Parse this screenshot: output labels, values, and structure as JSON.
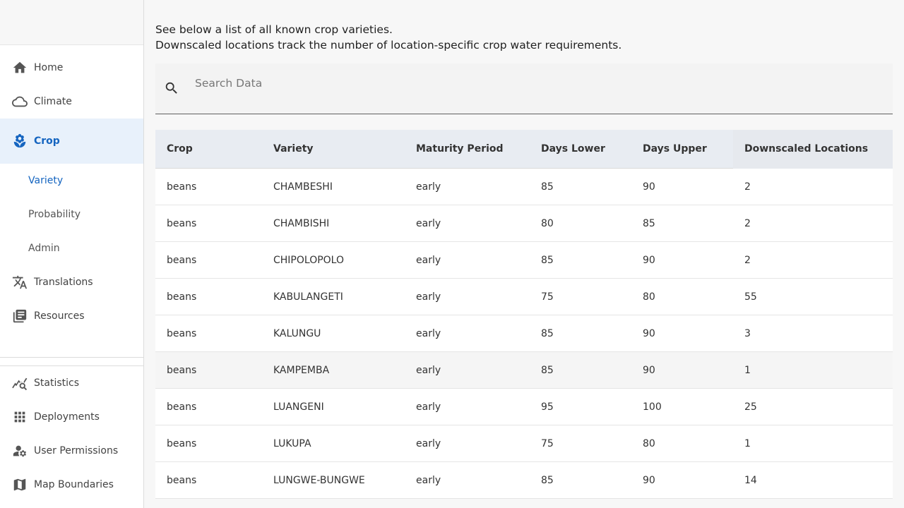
{
  "sidebar": {
    "nav_top": [
      {
        "label": "Home",
        "icon": "home-icon"
      },
      {
        "label": "Climate",
        "icon": "cloud-icon"
      },
      {
        "label": "Crop",
        "icon": "sprout-icon"
      }
    ],
    "sub_items": [
      {
        "label": "Variety"
      },
      {
        "label": "Probability"
      },
      {
        "label": "Admin"
      }
    ],
    "nav_mid": [
      {
        "label": "Translations",
        "icon": "translate-icon"
      },
      {
        "label": "Resources",
        "icon": "library-icon"
      }
    ],
    "nav_bottom": [
      {
        "label": "Statistics",
        "icon": "stats-icon"
      },
      {
        "label": "Deployments",
        "icon": "apps-grid-icon"
      },
      {
        "label": "User Permissions",
        "icon": "user-settings-icon"
      },
      {
        "label": "Map Boundaries",
        "icon": "map-icon"
      }
    ],
    "accent_color": "#1565c0"
  },
  "main": {
    "intro_line1": "See below a list of all known crop varieties.",
    "intro_line2": "Downscaled locations track the number of location-specific crop water requirements.",
    "search": {
      "placeholder": "Search Data",
      "value": ""
    },
    "table": {
      "headers": [
        "Crop",
        "Variety",
        "Maturity Period",
        "Days Lower",
        "Days Upper",
        "Downscaled Locations"
      ],
      "rows": [
        [
          "beans",
          "CHAMBESHI",
          "early",
          "85",
          "90",
          "2"
        ],
        [
          "beans",
          "CHAMBISHI",
          "early",
          "80",
          "85",
          "2"
        ],
        [
          "beans",
          "CHIPOLOPOLO",
          "early",
          "85",
          "90",
          "2"
        ],
        [
          "beans",
          "KABULANGETI",
          "early",
          "75",
          "80",
          "55"
        ],
        [
          "beans",
          "KALUNGU",
          "early",
          "85",
          "90",
          "3"
        ],
        [
          "beans",
          "KAMPEMBA",
          "early",
          "85",
          "90",
          "1"
        ],
        [
          "beans",
          "LUANGENI",
          "early",
          "95",
          "100",
          "25"
        ],
        [
          "beans",
          "LUKUPA",
          "early",
          "75",
          "80",
          "1"
        ],
        [
          "beans",
          "LUNGWE-BUNGWE",
          "early",
          "85",
          "90",
          "14"
        ]
      ]
    }
  }
}
